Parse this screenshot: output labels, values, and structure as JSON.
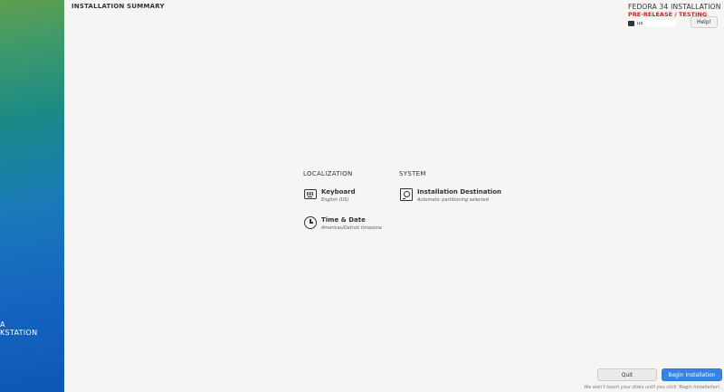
{
  "window": {
    "title": "INSTALLATION SUMMARY",
    "product": "FEDORA 34 INSTALLATION",
    "prerelease": "PRE-RELEASE / TESTING",
    "keyboard_layout": "us",
    "help_label": "Help!"
  },
  "sidebar": {
    "brand_line1": "A",
    "brand_line2": "KSTATION"
  },
  "sections": {
    "localization": {
      "title": "LOCALIZATION",
      "spokes": [
        {
          "name": "Keyboard",
          "status": "English (US)",
          "icon": "keyboard-icon"
        },
        {
          "name": "Time & Date",
          "status": "Americas/Detroit timezone",
          "icon": "clock-icon"
        }
      ]
    },
    "system": {
      "title": "SYSTEM",
      "spokes": [
        {
          "name": "Installation Destination",
          "status": "Automatic partitioning selected",
          "icon": "disk-icon"
        }
      ]
    }
  },
  "footer": {
    "quit_label": "Quit",
    "begin_label": "Begin Installation",
    "note": "We won't touch your disks until you click 'Begin Installation'."
  },
  "colors": {
    "accent": "#3584e4",
    "warning": "#e01b24",
    "background": "#f6f5f4"
  }
}
